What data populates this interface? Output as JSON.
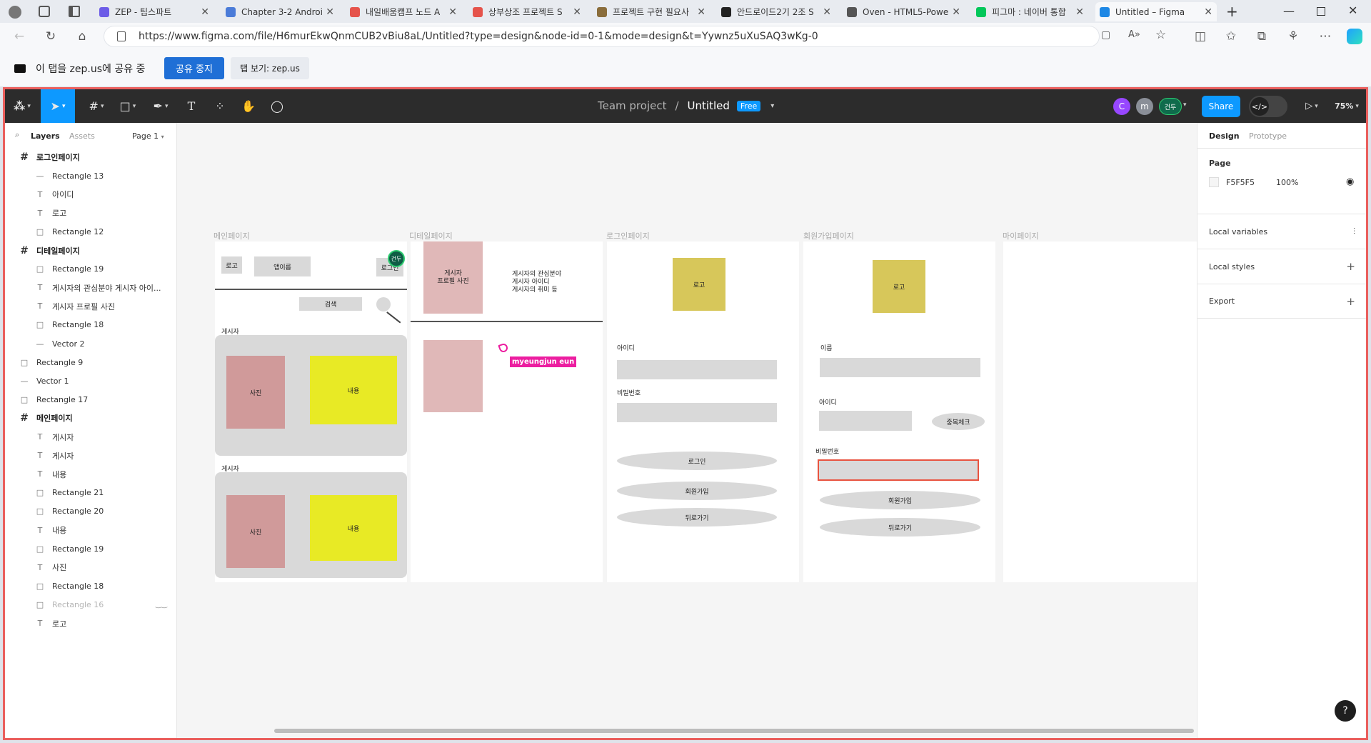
{
  "tabs": [
    {
      "title": "ZEP - 팁스파트 ",
      "color": "#6c5ce7"
    },
    {
      "title": "Chapter 3-2 Android",
      "color": "#4a7bd8"
    },
    {
      "title": "내일배움캠프 노드 A",
      "color": "#e5534b"
    },
    {
      "title": "상부상조 프로젝트 S",
      "color": "#e5534b"
    },
    {
      "title": "프로젝트 구현 필요사",
      "color": "#8a6d3b"
    },
    {
      "title": "안드로이드2기 2조 S",
      "color": "#222222"
    },
    {
      "title": "Oven - HTML5-Powe",
      "color": "#555555"
    },
    {
      "title": "피그마 : 네이버 통합",
      "color": "#03c75a"
    },
    {
      "title": "Untitled – Figma",
      "color": "#1e88e5"
    }
  ],
  "address": {
    "url": "https://www.figma.com/file/H6murEkwQnmCUB2vBiu8aL/Untitled?type=design&node-id=0-1&mode=design&t=Yywnz5uXuSAQ3wKg-0"
  },
  "sharebar": {
    "message": "이 탭을 zep.us에 공유 중",
    "stop": "공유 중지",
    "view": "탭 보기: zep.us"
  },
  "figma": {
    "team": "Team project",
    "separator": "/",
    "file": "Untitled",
    "plan": "Free",
    "share": "Share",
    "zoom": "75%",
    "avatars": [
      {
        "label": "C",
        "color": "#9747ff"
      },
      {
        "label": "m",
        "color": "#8a8f98"
      },
      {
        "label": "건두",
        "color": "#0f6b4c"
      }
    ],
    "dev_mode": "</>"
  },
  "left_panel": {
    "tabs": [
      "Layers",
      "Assets"
    ],
    "page_select": "Page 1",
    "layers": [
      {
        "name": "로그인페이지",
        "type": "frame"
      },
      {
        "name": "Rectangle 13",
        "type": "line"
      },
      {
        "name": "아이디",
        "type": "text"
      },
      {
        "name": "로고",
        "type": "text"
      },
      {
        "name": "Rectangle 12",
        "type": "rect"
      },
      {
        "name": "디테일페이지",
        "type": "frame"
      },
      {
        "name": "Rectangle 19",
        "type": "rect"
      },
      {
        "name": "게시자의 관심분야 게시자 아이...",
        "type": "text"
      },
      {
        "name": "게시자 프로필 사진",
        "type": "text"
      },
      {
        "name": "Rectangle 18",
        "type": "rect"
      },
      {
        "name": "Vector 2",
        "type": "line"
      },
      {
        "name": "Rectangle 9",
        "type": "rect",
        "top": true
      },
      {
        "name": "Vector 1",
        "type": "line",
        "top": true
      },
      {
        "name": "Rectangle 17",
        "type": "rect",
        "top": true
      },
      {
        "name": "메인페이지",
        "type": "frame"
      },
      {
        "name": "게시자",
        "type": "text"
      },
      {
        "name": "게시자",
        "type": "text"
      },
      {
        "name": "내용",
        "type": "text"
      },
      {
        "name": "Rectangle 21",
        "type": "rect"
      },
      {
        "name": "Rectangle 20",
        "type": "rect"
      },
      {
        "name": "내용",
        "type": "text"
      },
      {
        "name": "Rectangle 19",
        "type": "rect"
      },
      {
        "name": "사진",
        "type": "text"
      },
      {
        "name": "Rectangle 18",
        "type": "rect"
      },
      {
        "name": "Rectangle 16",
        "type": "rect",
        "dim": true
      },
      {
        "name": "로고",
        "type": "text"
      }
    ]
  },
  "right_panel": {
    "tabs": [
      "Design",
      "Prototype"
    ],
    "page_heading": "Page",
    "page_color": "F5F5F5",
    "page_opacity": "100%",
    "sections": [
      "Local variables",
      "Local styles",
      "Export"
    ]
  },
  "canvas": {
    "frame_labels": [
      "메인페이지",
      "디테일페이지",
      "로그인페이지",
      "회원가입페이지",
      "마이페이지"
    ],
    "main": {
      "logo": "로고",
      "app_name": "앱이름",
      "login": "로그인",
      "search": "검색",
      "poster": "게시자",
      "photo": "사진",
      "content": "내용",
      "avatar_label": "건두"
    },
    "detail": {
      "profile_photo": "게시자\n프로필 사진",
      "info_lines": [
        "게시자의 관심분야",
        "게시자 아이디",
        "게시자의 취미 등"
      ],
      "cursor_name": "myeungjun eun"
    },
    "login": {
      "logo": "로고",
      "id_label": "아이디",
      "pw_label": "비밀번호",
      "login_btn": "로그인",
      "signup_btn": "회원가입",
      "back_btn": "뒤로가기"
    },
    "signup": {
      "logo": "로고",
      "name_label": "이름",
      "id_label": "아이디",
      "dup_check": "중복체크",
      "pw_label": "비밀번호",
      "signup_btn": "회원가입",
      "back_btn": "뒤로가기"
    }
  },
  "colors": {
    "figma_blue": "#0d99ff",
    "selection_red": "#e8533f",
    "logo_yellow": "#d7c75a",
    "content_yellow": "#e8ea25",
    "photo_rose": "#d09a9a",
    "detail_rose": "#e0b8b8",
    "cursor_pink": "#ec1ea0"
  }
}
